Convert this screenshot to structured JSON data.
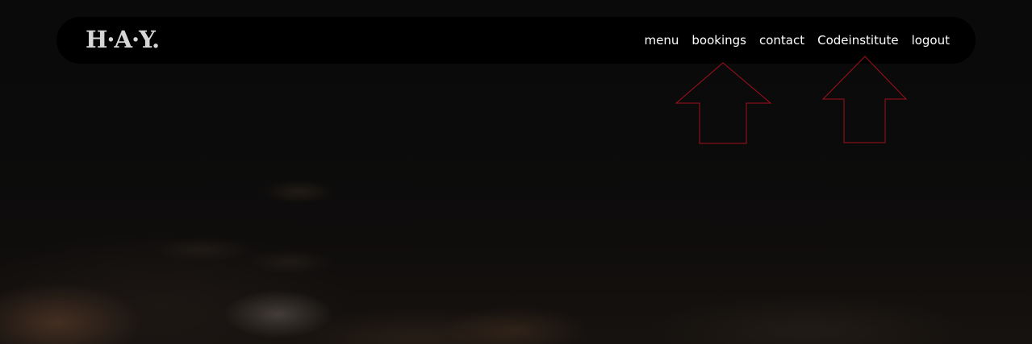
{
  "brand": {
    "logo_text": "H·A·Y."
  },
  "nav": {
    "items": [
      {
        "label": "menu"
      },
      {
        "label": "bookings"
      },
      {
        "label": "contact"
      },
      {
        "label": "Codeinstitute"
      },
      {
        "label": "logout"
      }
    ]
  },
  "annotations": {
    "arrow_color": "#a0101a",
    "arrows": [
      {
        "points_to": "bookings",
        "icon": "up-arrow-icon"
      },
      {
        "points_to": "Codeinstitute",
        "icon": "up-arrow-icon"
      }
    ]
  },
  "colors": {
    "navbar_bg": "#000000",
    "nav_text": "#ffffff",
    "logo_text": "#d6d6d6",
    "page_bg": "#0a0a0a"
  }
}
